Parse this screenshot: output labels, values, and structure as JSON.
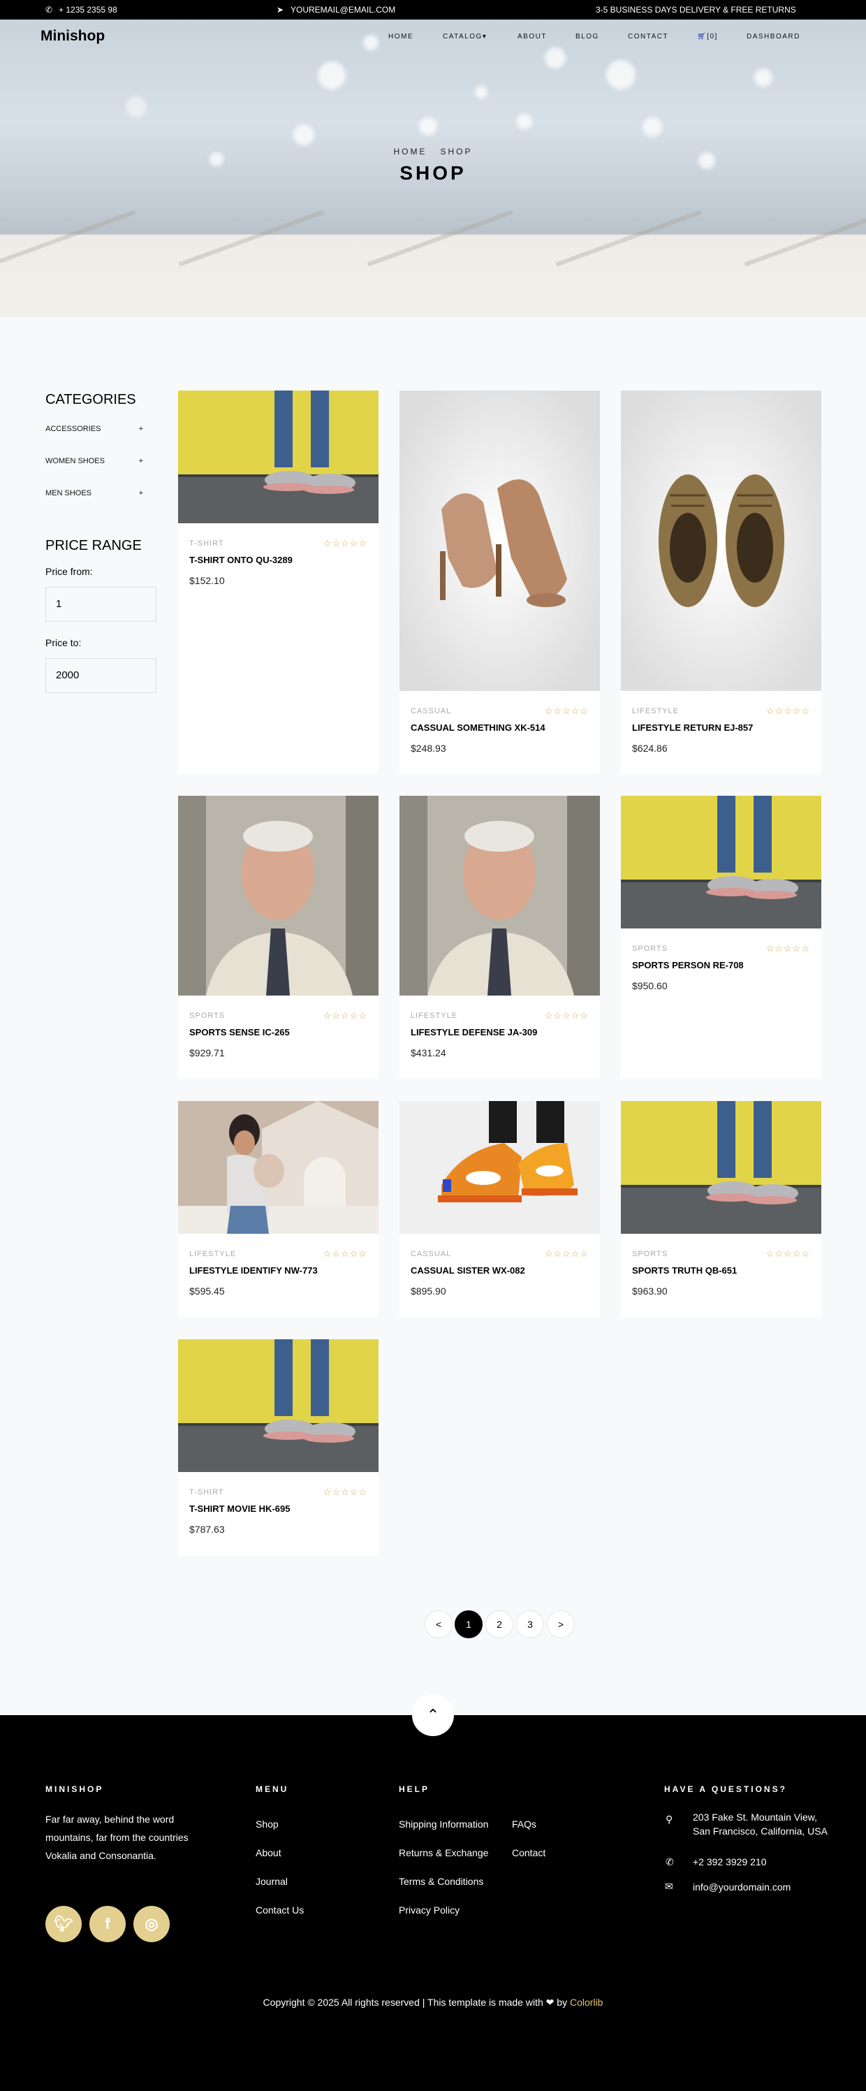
{
  "topbar": {
    "phone": "+ 1235 2355 98",
    "email": "YOUREMAIL@EMAIL.COM",
    "promo": "3-5 BUSINESS DAYS DELIVERY & FREE RETURNS"
  },
  "nav": {
    "logo": "Minishop",
    "items": [
      "HOME",
      "CATALOG",
      "ABOUT",
      "BLOG",
      "CONTACT",
      "[0]",
      "DASHBOARD"
    ]
  },
  "hero": {
    "breadcrumb_home": "HOME",
    "breadcrumb_shop": "SHOP",
    "title": "SHOP"
  },
  "sidebar": {
    "categories_title": "CATEGORIES",
    "categories": [
      "ACCESSORIES",
      "WOMEN SHOES",
      "MEN SHOES"
    ],
    "price_title": "PRICE RANGE",
    "price_from_label": "Price from:",
    "price_from_value": "1",
    "price_to_label": "Price to:",
    "price_to_value": "2000"
  },
  "products": [
    {
      "category": "T-SHIRT",
      "name": "T-SHIRT ONTO QU-3289",
      "price": "$152.10",
      "image": "sneakers-yellow-wall"
    },
    {
      "category": "CASSUAL",
      "name": "CASSUAL SOMETHING XK-514",
      "price": "$248.93",
      "image": "heels"
    },
    {
      "category": "LIFESTYLE",
      "name": "LIFESTYLE RETURN EJ-857",
      "price": "$624.86",
      "image": "brown-shoes"
    },
    {
      "category": "SPORTS",
      "name": "SPORTS SENSE IC-265",
      "price": "$929.71",
      "image": "man-portrait"
    },
    {
      "category": "LIFESTYLE",
      "name": "LIFESTYLE DEFENSE JA-309",
      "price": "$431.24",
      "image": "man-portrait"
    },
    {
      "category": "SPORTS",
      "name": "SPORTS PERSON RE-708",
      "price": "$950.60",
      "image": "sneakers-yellow-wall"
    },
    {
      "category": "LIFESTYLE",
      "name": "LIFESTYLE IDENTIFY NW-773",
      "price": "$595.45",
      "image": "mother-child"
    },
    {
      "category": "CASSUAL",
      "name": "CASSUAL SISTER WX-082",
      "price": "$895.90",
      "image": "orange-sneakers"
    },
    {
      "category": "SPORTS",
      "name": "SPORTS TRUTH QB-651",
      "price": "$963.90",
      "image": "sneakers-yellow-wall"
    },
    {
      "category": "T-SHIRT",
      "name": "T-SHIRT MOVIE HK-695",
      "price": "$787.63",
      "image": "sneakers-yellow-wall"
    }
  ],
  "stars": "☆☆☆☆☆",
  "pagination": [
    "<",
    "1",
    "2",
    "3",
    ">"
  ],
  "footer": {
    "brand": "MINISHOP",
    "about": "Far far away, behind the word mountains, far from the countries Vokalia and Consonantia.",
    "menu_title": "MENU",
    "menu": [
      "Shop",
      "About",
      "Journal",
      "Contact Us"
    ],
    "help_title": "HELP",
    "help_col1": [
      "Shipping Information",
      "Returns & Exchange",
      "Terms & Conditions",
      "Privacy Policy"
    ],
    "help_col2": [
      "FAQs",
      "Contact"
    ],
    "questions_title": "HAVE A QUESTIONS?",
    "address": "203 Fake St. Mountain View, San Francisco, California, USA",
    "phone": "+2 392 3929 210",
    "email": "info@yourdomain.com",
    "copyright": "Copyright © 2025 All rights reserved | This template is made with",
    "by": "by",
    "credit": "Colorlib"
  },
  "colors": {
    "accent": "#e3cf8f",
    "dark": "#000000",
    "star": "#d4a94e"
  }
}
